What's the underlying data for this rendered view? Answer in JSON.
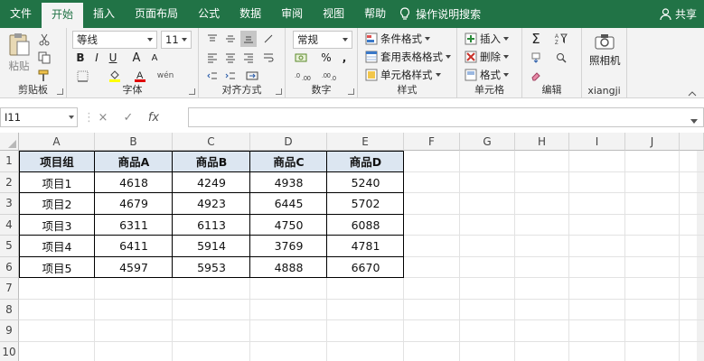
{
  "tabs": [
    "文件",
    "开始",
    "插入",
    "页面布局",
    "公式",
    "数据",
    "审阅",
    "视图",
    "帮助"
  ],
  "active_tab": "开始",
  "tell_me": "操作说明搜索",
  "share": "共享",
  "ribbon": {
    "clipboard": {
      "paste": "粘贴",
      "label": "剪贴板"
    },
    "font": {
      "name": "等线",
      "size": "11",
      "label": "字体",
      "bold": "B",
      "italic": "I",
      "underline": "U",
      "grow": "A",
      "shrink": "A",
      "wen": "wén"
    },
    "alignment": {
      "label": "对齐方式"
    },
    "number": {
      "format": "常规",
      "label": "数字",
      "percent": "%",
      "comma": ","
    },
    "styles": {
      "conditional": "条件格式",
      "table": "套用表格格式",
      "cell_styles": "单元格样式",
      "label": "样式"
    },
    "cells": {
      "insert": "插入",
      "delete": "删除",
      "format": "格式",
      "label": "单元格"
    },
    "editing": {
      "label": "编辑"
    },
    "camera": {
      "button": "照相机",
      "label": "xiangji"
    }
  },
  "formula_bar": {
    "name_box": "I11",
    "cancel": "×",
    "enter": "✓",
    "fx": "fx",
    "formula": ""
  },
  "columns": [
    "A",
    "B",
    "C",
    "D",
    "E",
    "F",
    "G",
    "H",
    "I",
    "J"
  ],
  "rows": [
    "1",
    "2",
    "3",
    "4",
    "5",
    "6",
    "7",
    "8",
    "9",
    "10"
  ],
  "table": {
    "headers": [
      "项目组",
      "商品A",
      "商品B",
      "商品C",
      "商品D"
    ],
    "data": [
      [
        "项目1",
        "4618",
        "4249",
        "4938",
        "5240"
      ],
      [
        "项目2",
        "4679",
        "4923",
        "6445",
        "5702"
      ],
      [
        "项目3",
        "6311",
        "6113",
        "4750",
        "6088"
      ],
      [
        "项目4",
        "6411",
        "5914",
        "3769",
        "4781"
      ],
      [
        "项目5",
        "4597",
        "5953",
        "4888",
        "6670"
      ]
    ]
  },
  "colors": {
    "accent": "#217346",
    "header_fill": "#dce6f1"
  }
}
